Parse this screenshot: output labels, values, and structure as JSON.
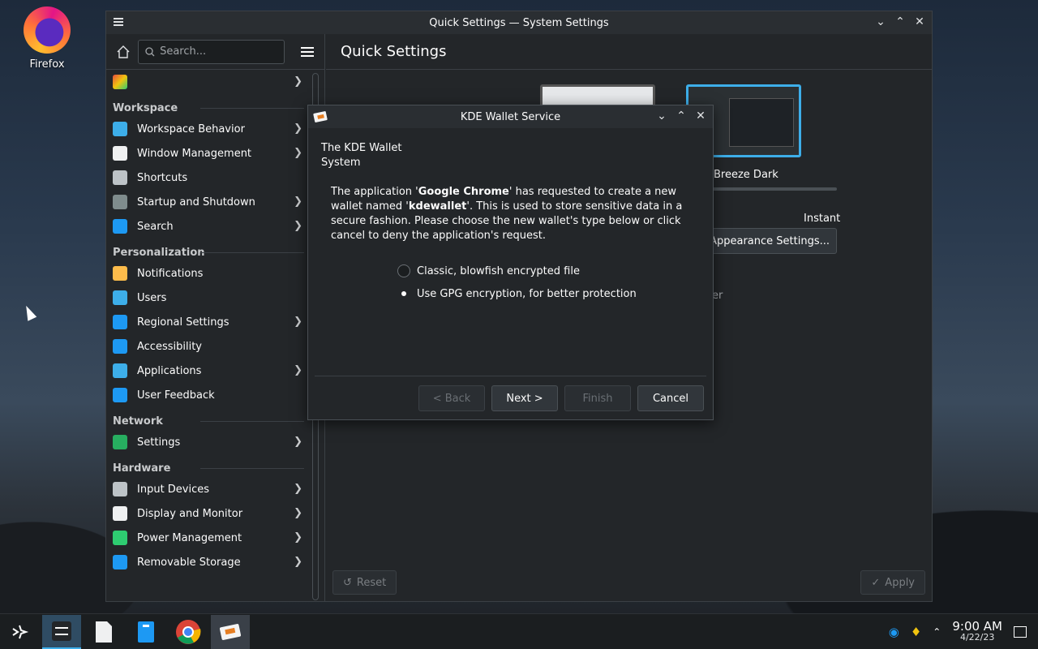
{
  "desktop": {
    "icons": [
      {
        "label": "Firefox",
        "icon": "firefox-icon"
      }
    ]
  },
  "settings_window": {
    "title": "Quick Settings — System Settings",
    "search_placeholder": "Search...",
    "header": "Quick Settings",
    "sections": [
      {
        "title": "Workspace",
        "items": [
          {
            "label": "Workspace Behavior",
            "chevron": true,
            "color": "#3daee9"
          },
          {
            "label": "Window Management",
            "chevron": true,
            "color": "#eff0f1"
          },
          {
            "label": "Shortcuts",
            "chevron": false,
            "color": "#bdc3c7"
          },
          {
            "label": "Startup and Shutdown",
            "chevron": true,
            "color": "#7f8c8d"
          },
          {
            "label": "Search",
            "chevron": true,
            "color": "#1d99f3"
          }
        ]
      },
      {
        "title": "Personalization",
        "items": [
          {
            "label": "Notifications",
            "chevron": false,
            "color": "#fdbc4b"
          },
          {
            "label": "Users",
            "chevron": false,
            "color": "#3daee9"
          },
          {
            "label": "Regional Settings",
            "chevron": true,
            "color": "#1d99f3"
          },
          {
            "label": "Accessibility",
            "chevron": false,
            "color": "#1d99f3"
          },
          {
            "label": "Applications",
            "chevron": true,
            "color": "#3daee9"
          },
          {
            "label": "User Feedback",
            "chevron": false,
            "color": "#1d99f3"
          }
        ]
      },
      {
        "title": "Network",
        "items": [
          {
            "label": "Settings",
            "chevron": true,
            "color": "#27ae60"
          }
        ]
      },
      {
        "title": "Hardware",
        "items": [
          {
            "label": "Input Devices",
            "chevron": true,
            "color": "#bdc3c7"
          },
          {
            "label": "Display and Monitor",
            "chevron": true,
            "color": "#eff0f1"
          },
          {
            "label": "Power Management",
            "chevron": true,
            "color": "#2ecc71"
          },
          {
            "label": "Removable Storage",
            "chevron": true,
            "color": "#1d99f3"
          }
        ]
      }
    ],
    "theme_label": "Breeze Dark",
    "animation_speed_label": "Instant",
    "appearance_button": "e Appearance Settings...",
    "partial_text": "er",
    "reset_button": "Reset",
    "apply_button": "Apply"
  },
  "wallet_dialog": {
    "title": "KDE Wallet Service",
    "heading_line1": "The KDE Wallet",
    "heading_line2": "System",
    "text_part1": "The application '",
    "app_name": "Google Chrome",
    "text_part2": "' has requested to create a new wallet named '",
    "wallet_name": "kdewallet",
    "text_part3": "'. This is used to store sensitive data in a secure fashion. Please choose the new wallet's type below or click cancel to deny the application's request.",
    "option_classic": "Classic, blowfish encrypted file",
    "option_gpg": "Use GPG encryption, for better protection",
    "selected_option": "gpg",
    "buttons": {
      "back": "< Back",
      "next": "Next >",
      "finish": "Finish",
      "cancel": "Cancel"
    }
  },
  "taskbar": {
    "clock_time": "9:00 AM",
    "clock_date": "4/22/23"
  },
  "colors": {
    "accent": "#3daee9",
    "window_bg": "#232629",
    "panel_bg": "#1b1e20"
  }
}
